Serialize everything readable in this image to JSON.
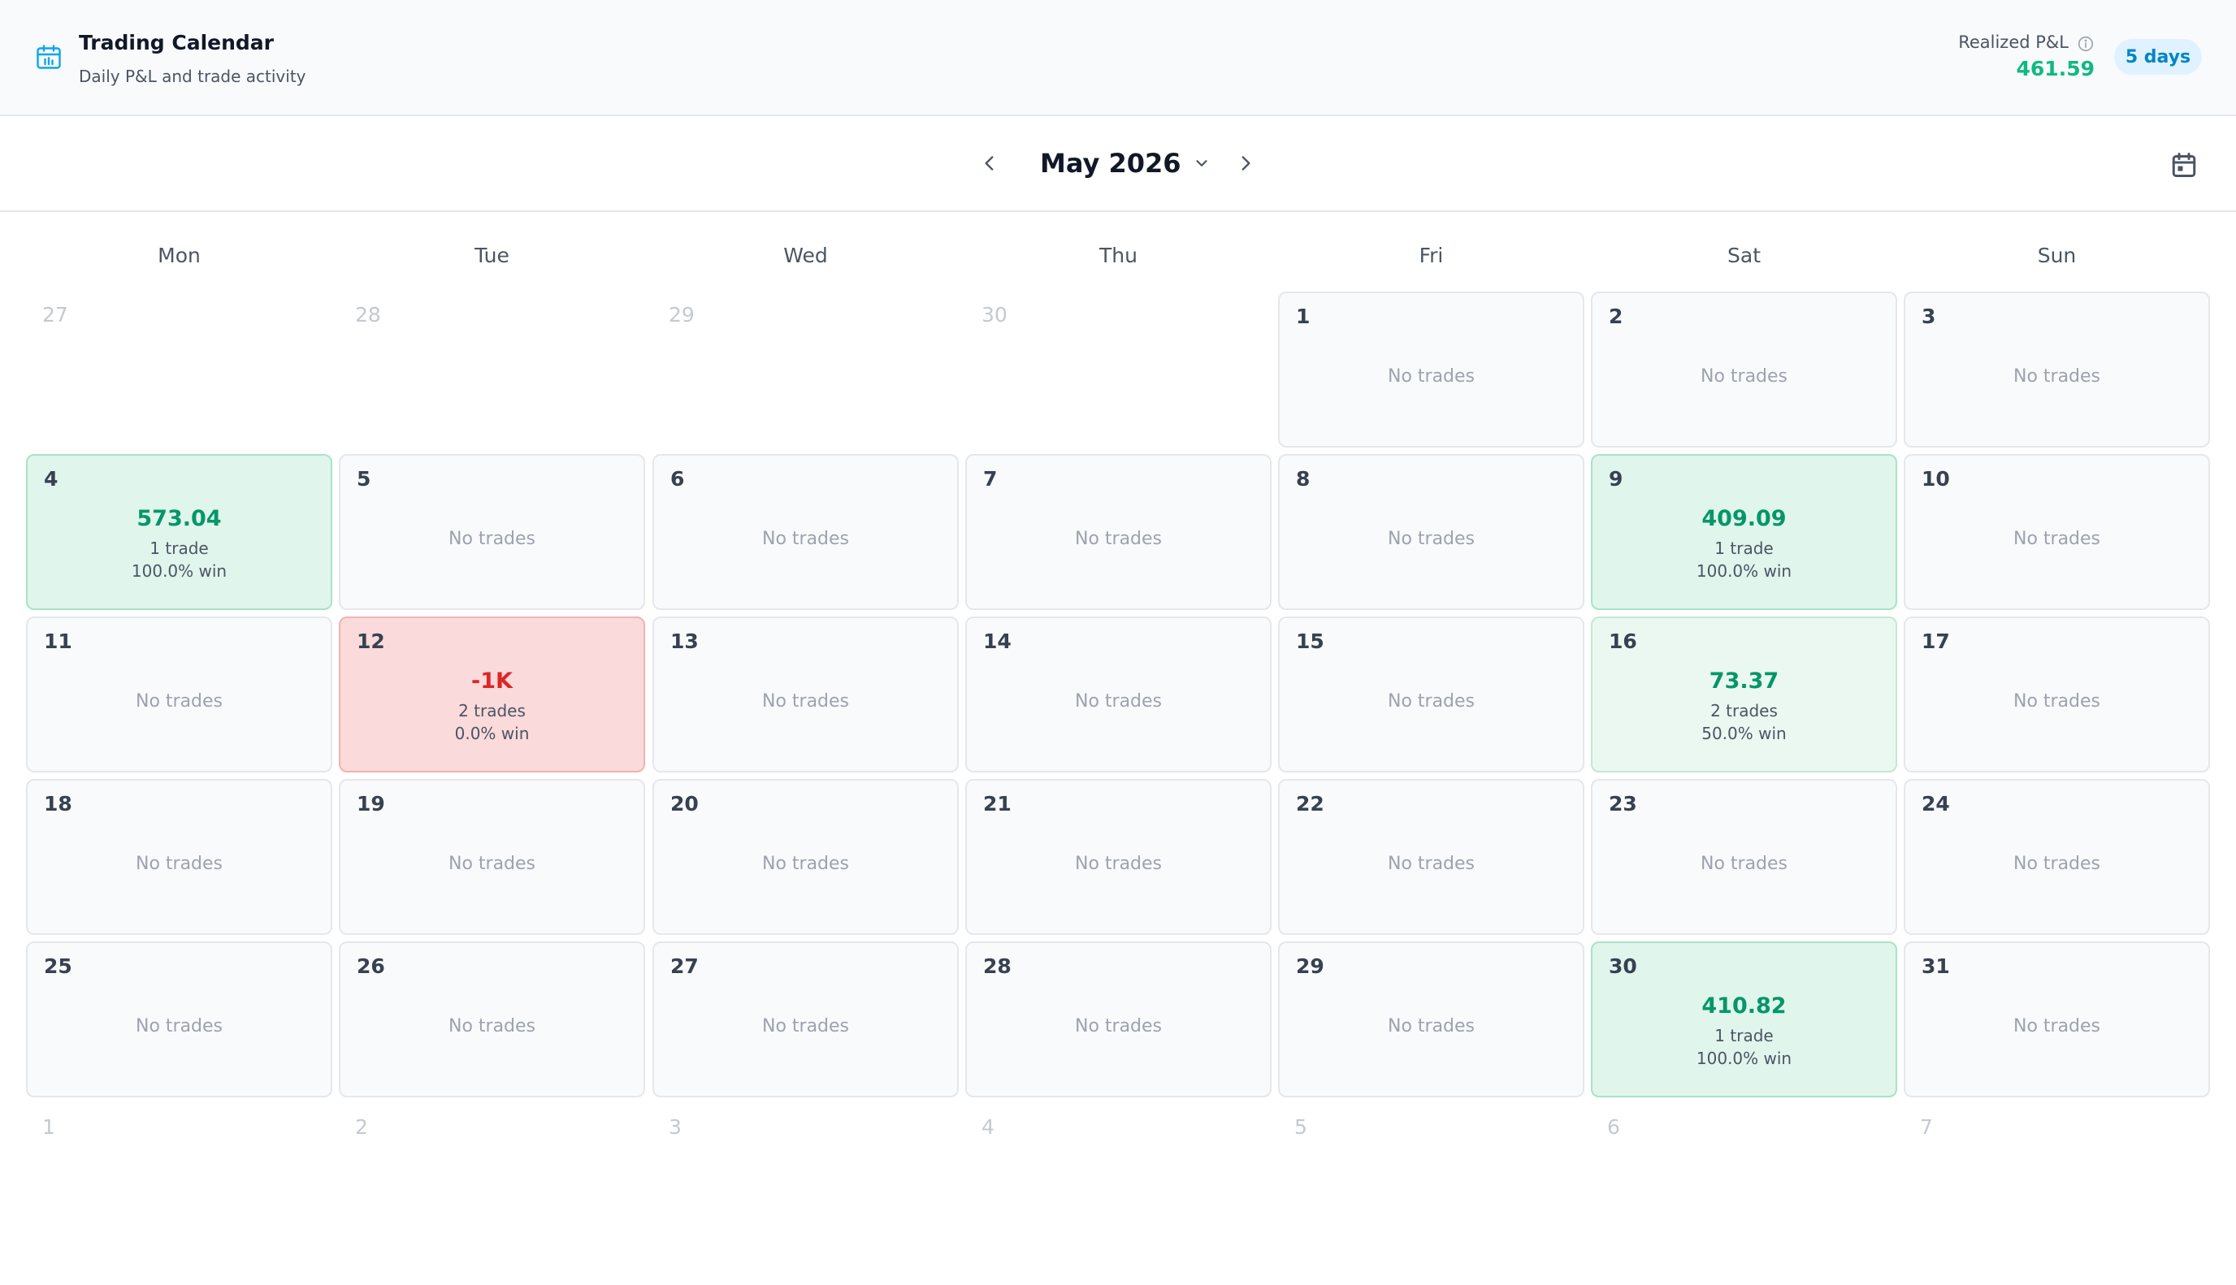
{
  "header": {
    "title": "Trading Calendar",
    "subtitle": "Daily P&L and trade activity",
    "realized_label": "Realized P&L",
    "realized_value": "461.59",
    "days_badge": "5 days"
  },
  "nav": {
    "month": "May 2026"
  },
  "weekdays": [
    "Mon",
    "Tue",
    "Wed",
    "Thu",
    "Fri",
    "Sat",
    "Sun"
  ],
  "colors": {
    "profit": "#059669",
    "loss": "#dc2626",
    "accent": "#0ea5e9"
  },
  "icons": {
    "logo": "calendar-icon",
    "info": "info-icon",
    "prev": "chevron-left-icon",
    "next": "chevron-right-icon",
    "dropdown": "chevron-down-icon",
    "calendar_button": "calendar-icon"
  },
  "no_trades_text": "No trades",
  "weeks": [
    [
      {
        "day": "27",
        "out": true
      },
      {
        "day": "28",
        "out": true
      },
      {
        "day": "29",
        "out": true
      },
      {
        "day": "30",
        "out": true
      },
      {
        "day": "1"
      },
      {
        "day": "2"
      },
      {
        "day": "3"
      }
    ],
    [
      {
        "day": "4",
        "pnl": "573.04",
        "trades": "1 trade",
        "win": "100.0% win",
        "status": "profit"
      },
      {
        "day": "5"
      },
      {
        "day": "6"
      },
      {
        "day": "7"
      },
      {
        "day": "8"
      },
      {
        "day": "9",
        "pnl": "409.09",
        "trades": "1 trade",
        "win": "100.0% win",
        "status": "profit"
      },
      {
        "day": "10"
      }
    ],
    [
      {
        "day": "11"
      },
      {
        "day": "12",
        "pnl": "-1K",
        "trades": "2 trades",
        "win": "0.0% win",
        "status": "loss"
      },
      {
        "day": "13"
      },
      {
        "day": "14"
      },
      {
        "day": "15"
      },
      {
        "day": "16",
        "pnl": "73.37",
        "trades": "2 trades",
        "win": "50.0% win",
        "status": "profit-light"
      },
      {
        "day": "17"
      }
    ],
    [
      {
        "day": "18"
      },
      {
        "day": "19"
      },
      {
        "day": "20"
      },
      {
        "day": "21"
      },
      {
        "day": "22"
      },
      {
        "day": "23"
      },
      {
        "day": "24"
      }
    ],
    [
      {
        "day": "25"
      },
      {
        "day": "26"
      },
      {
        "day": "27"
      },
      {
        "day": "28"
      },
      {
        "day": "29"
      },
      {
        "day": "30",
        "pnl": "410.82",
        "trades": "1 trade",
        "win": "100.0% win",
        "status": "profit"
      },
      {
        "day": "31"
      }
    ],
    [
      {
        "day": "1",
        "out": true
      },
      {
        "day": "2",
        "out": true
      },
      {
        "day": "3",
        "out": true
      },
      {
        "day": "4",
        "out": true
      },
      {
        "day": "5",
        "out": true
      },
      {
        "day": "6",
        "out": true
      },
      {
        "day": "7",
        "out": true
      }
    ]
  ]
}
